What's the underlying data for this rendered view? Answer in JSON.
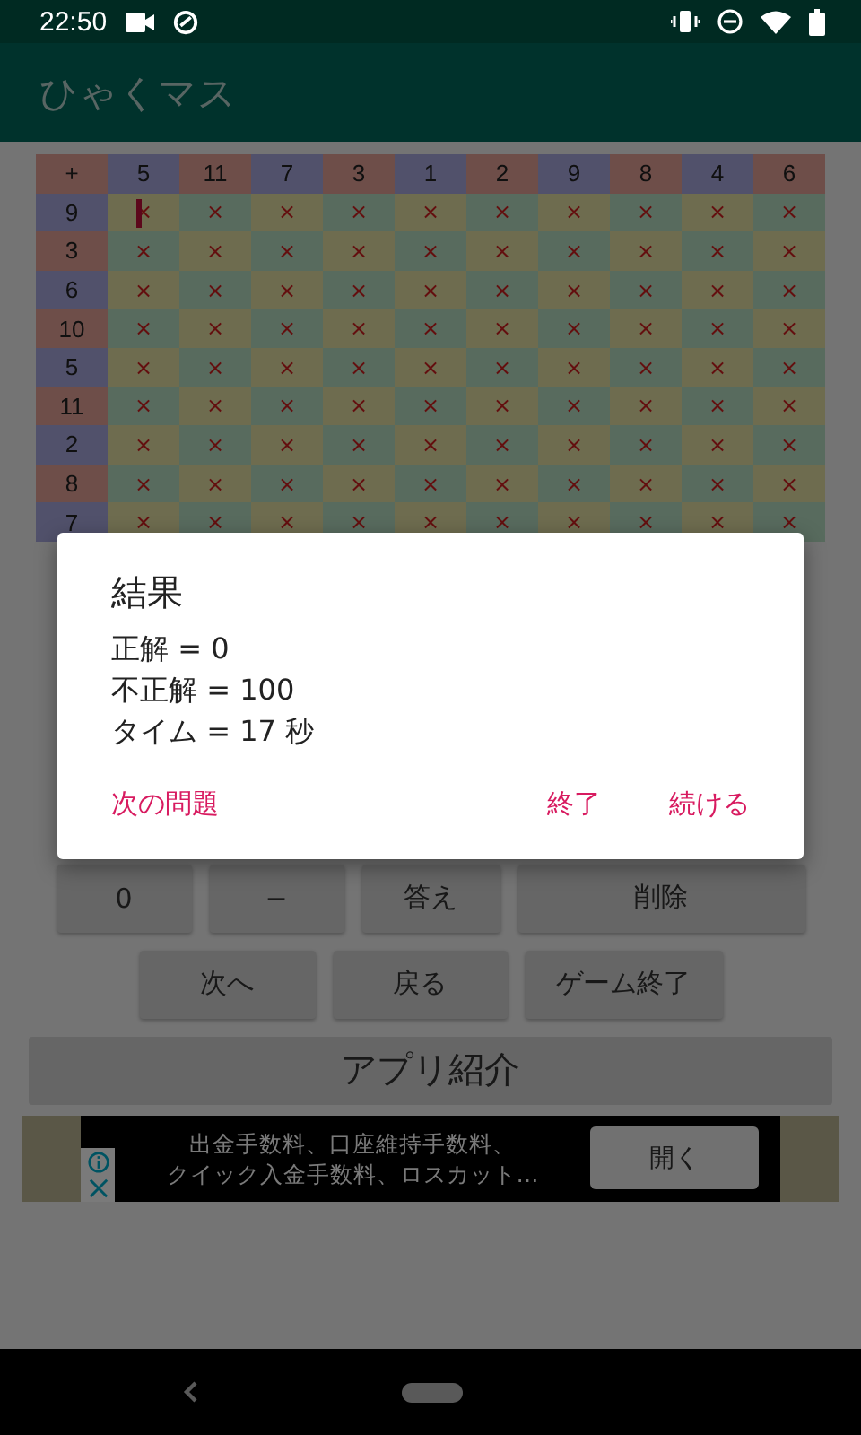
{
  "status_bar": {
    "time": "22:50"
  },
  "app_bar": {
    "title": "ひゃくマス"
  },
  "grid": {
    "corner": "+",
    "columns": [
      "5",
      "11",
      "7",
      "3",
      "1",
      "2",
      "9",
      "8",
      "4",
      "6"
    ],
    "rows": [
      {
        "label": "9",
        "cells": [
          {
            "text": "×",
            "focused": true
          },
          {
            "text": "×",
            "focused": false
          },
          {
            "text": "×",
            "focused": false
          },
          {
            "text": "×",
            "focused": false
          },
          {
            "text": "×",
            "focused": false
          },
          {
            "text": "×",
            "focused": false
          },
          {
            "text": "×",
            "focused": false
          },
          {
            "text": "×",
            "focused": false
          },
          {
            "text": "×",
            "focused": false
          },
          {
            "text": "×",
            "focused": false
          }
        ]
      },
      {
        "label": "3",
        "cells": [
          {
            "text": "×",
            "focused": false
          },
          {
            "text": "×",
            "focused": false
          },
          {
            "text": "×",
            "focused": false
          },
          {
            "text": "×",
            "focused": false
          },
          {
            "text": "×",
            "focused": false
          },
          {
            "text": "×",
            "focused": false
          },
          {
            "text": "×",
            "focused": false
          },
          {
            "text": "×",
            "focused": false
          },
          {
            "text": "×",
            "focused": false
          },
          {
            "text": "×",
            "focused": false
          }
        ]
      },
      {
        "label": "6",
        "cells": [
          {
            "text": "×",
            "focused": false
          },
          {
            "text": "×",
            "focused": false
          },
          {
            "text": "×",
            "focused": false
          },
          {
            "text": "×",
            "focused": false
          },
          {
            "text": "×",
            "focused": false
          },
          {
            "text": "×",
            "focused": false
          },
          {
            "text": "×",
            "focused": false
          },
          {
            "text": "×",
            "focused": false
          },
          {
            "text": "×",
            "focused": false
          },
          {
            "text": "×",
            "focused": false
          }
        ]
      },
      {
        "label": "10",
        "cells": [
          {
            "text": "×",
            "focused": false
          },
          {
            "text": "×",
            "focused": false
          },
          {
            "text": "×",
            "focused": false
          },
          {
            "text": "×",
            "focused": false
          },
          {
            "text": "×",
            "focused": false
          },
          {
            "text": "×",
            "focused": false
          },
          {
            "text": "×",
            "focused": false
          },
          {
            "text": "×",
            "focused": false
          },
          {
            "text": "×",
            "focused": false
          },
          {
            "text": "×",
            "focused": false
          }
        ]
      },
      {
        "label": "5",
        "cells": [
          {
            "text": "×",
            "focused": false
          },
          {
            "text": "×",
            "focused": false
          },
          {
            "text": "×",
            "focused": false
          },
          {
            "text": "×",
            "focused": false
          },
          {
            "text": "×",
            "focused": false
          },
          {
            "text": "×",
            "focused": false
          },
          {
            "text": "×",
            "focused": false
          },
          {
            "text": "×",
            "focused": false
          },
          {
            "text": "×",
            "focused": false
          },
          {
            "text": "×",
            "focused": false
          }
        ]
      },
      {
        "label": "11",
        "cells": [
          {
            "text": "×",
            "focused": false
          },
          {
            "text": "×",
            "focused": false
          },
          {
            "text": "×",
            "focused": false
          },
          {
            "text": "×",
            "focused": false
          },
          {
            "text": "×",
            "focused": false
          },
          {
            "text": "×",
            "focused": false
          },
          {
            "text": "×",
            "focused": false
          },
          {
            "text": "×",
            "focused": false
          },
          {
            "text": "×",
            "focused": false
          },
          {
            "text": "×",
            "focused": false
          }
        ]
      },
      {
        "label": "2",
        "cells": [
          {
            "text": "×",
            "focused": false
          },
          {
            "text": "×",
            "focused": false
          },
          {
            "text": "×",
            "focused": false
          },
          {
            "text": "×",
            "focused": false
          },
          {
            "text": "×",
            "focused": false
          },
          {
            "text": "×",
            "focused": false
          },
          {
            "text": "×",
            "focused": false
          },
          {
            "text": "×",
            "focused": false
          },
          {
            "text": "×",
            "focused": false
          },
          {
            "text": "×",
            "focused": false
          }
        ]
      },
      {
        "label": "8",
        "cells": [
          {
            "text": "×",
            "focused": false
          },
          {
            "text": "×",
            "focused": false
          },
          {
            "text": "×",
            "focused": false
          },
          {
            "text": "×",
            "focused": false
          },
          {
            "text": "×",
            "focused": false
          },
          {
            "text": "×",
            "focused": false
          },
          {
            "text": "×",
            "focused": false
          },
          {
            "text": "×",
            "focused": false
          },
          {
            "text": "×",
            "focused": false
          },
          {
            "text": "×",
            "focused": false
          }
        ]
      },
      {
        "label": "7",
        "cells": [
          {
            "text": "×",
            "focused": false
          },
          {
            "text": "×",
            "focused": false
          },
          {
            "text": "×",
            "focused": false
          },
          {
            "text": "×",
            "focused": false
          },
          {
            "text": "×",
            "focused": false
          },
          {
            "text": "×",
            "focused": false
          },
          {
            "text": "×",
            "focused": false
          },
          {
            "text": "×",
            "focused": false
          },
          {
            "text": "×",
            "focused": false
          },
          {
            "text": "×",
            "focused": false
          }
        ]
      }
    ]
  },
  "keypad": [
    "0",
    "−",
    "答え",
    "削除"
  ],
  "game_controls": [
    "次へ",
    "戻る",
    "ゲーム終了"
  ],
  "app_intro_button": "アプリ紹介",
  "ad": {
    "lines": [
      "出金手数料、口座維持手数料、",
      "クイック入金手数料、ロスカット…"
    ],
    "button": "開く"
  },
  "dialog": {
    "title": "結果",
    "lines": [
      "正解 =  0",
      "不正解 =  100",
      "タイム =  17 秒"
    ],
    "buttons": [
      "次の問題",
      "終了",
      "続ける"
    ]
  }
}
